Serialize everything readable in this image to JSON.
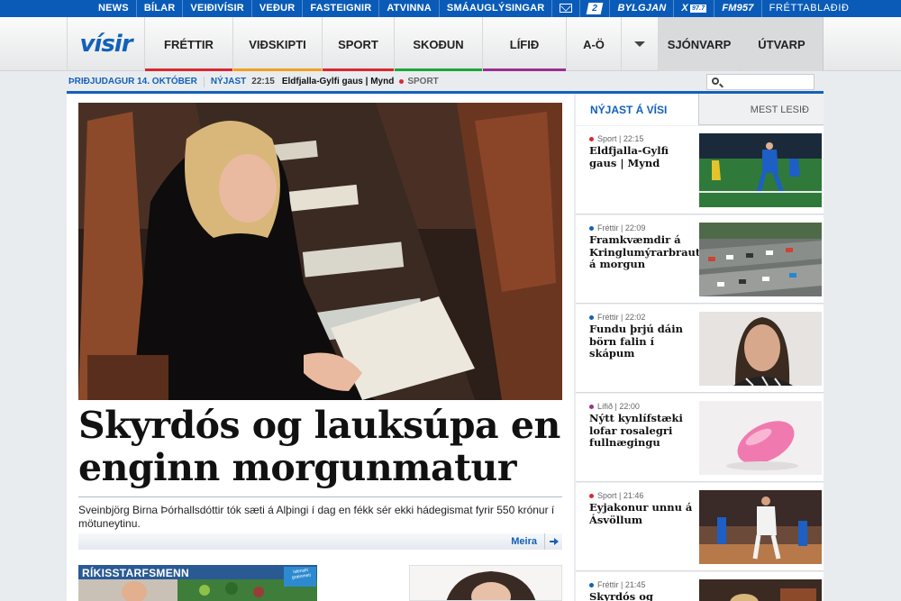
{
  "topbar": {
    "links": [
      "NEWS",
      "BÍLAR",
      "VEIÐIVÍSIR",
      "VEÐUR",
      "FASTEIGNIR",
      "ATVINNA",
      "SMÁAUGLÝSINGAR"
    ],
    "stod2": "2",
    "bylgjan": "BYLGJAN",
    "x": "X",
    "x_freq": "97.7",
    "fm": "FM957",
    "frettabladid": "FRÉTTABLAÐIÐ"
  },
  "nav": {
    "logo": "vísir",
    "items": [
      "FRÉTTIR",
      "VIÐSKIPTI",
      "SPORT",
      "SKOÐUN",
      "LÍFIÐ",
      "A-Ö"
    ],
    "underline_colors": [
      "#d9282f",
      "#f0a020",
      "#d9282f",
      "#1fa53a",
      "#9b2f8f",
      "#cfd2d6"
    ],
    "right_items": [
      "SJÓNVARP",
      "ÚTVARP"
    ]
  },
  "strip": {
    "date": "ÞRIÐJUDAGUR 14. OKTÓBER",
    "latest_label": "NÝJAST",
    "time": "22:15",
    "headline": "Eldfjalla-Gylfi gaus | Mynd",
    "category": "SPORT"
  },
  "main": {
    "headline": "Skyrdós og lauksúpa en enginn morgunmatur",
    "lede": "Sveinbjörg Birna Þórhallsdóttir tók sæti á Alþingi í dag en fékk sér ekki hádegismat fyrir 550 krónur í mötuneytinu.",
    "more": "Meira",
    "card1_title": "RÍKISSTARFSMENN",
    "card1_sticker": "íslenskt grænmeti"
  },
  "sidebar": {
    "tab_latest": "NÝJAST Á VÍSI",
    "tab_most_read": "MEST LESIÐ",
    "items": [
      {
        "meta": "Sport | 22:15",
        "title": "Eldfjalla-Gylfi gaus | Mynd",
        "dot": "#d9282f"
      },
      {
        "meta": "Fréttir | 22:09",
        "title": "Framkvæmdir á Kringlumýrarbraut á morgun",
        "dot": "#1261b9"
      },
      {
        "meta": "Fréttir | 22:02",
        "title": "Fundu þrjú dáin börn falin í skápum",
        "dot": "#1261b9"
      },
      {
        "meta": "Lífið | 22:00",
        "title": "Nýtt kynlífstæki lofar rosalegri fullnægingu",
        "dot": "#9b2f8f"
      },
      {
        "meta": "Sport | 21:46",
        "title": "Eyjakonur unnu á Ásvöllum",
        "dot": "#d9282f"
      },
      {
        "meta": "Fréttir | 21:45",
        "title": "Skyrdós og lauksúpa",
        "dot": "#1261b9"
      }
    ]
  }
}
